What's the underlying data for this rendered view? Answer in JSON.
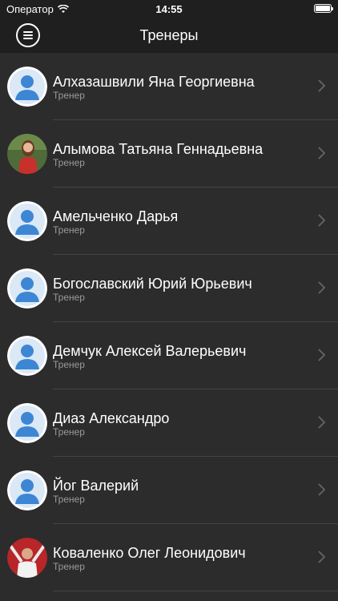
{
  "status": {
    "carrier": "Оператор",
    "time": "14:55"
  },
  "nav": {
    "title": "Тренеры"
  },
  "trainers": [
    {
      "name": "Алхазашвили Яна Георгиевна",
      "role": "Тренер",
      "avatar": "default-avatar"
    },
    {
      "name": "Алымова Татьяна Геннадьевна",
      "role": "Тренер",
      "avatar": "photo"
    },
    {
      "name": "Амельченко Дарья",
      "role": "Тренер",
      "avatar": "default-avatar"
    },
    {
      "name": "Богославский Юрий Юрьевич",
      "role": "Тренер",
      "avatar": "default-avatar"
    },
    {
      "name": "Демчук Алексей Валерьевич",
      "role": "Тренер",
      "avatar": "default-avatar"
    },
    {
      "name": "Диаз Александро",
      "role": "Тренер",
      "avatar": "default-avatar"
    },
    {
      "name": "Йог Валерий",
      "role": "Тренер",
      "avatar": "default-avatar"
    },
    {
      "name": "Коваленко Олег Леонидович",
      "role": "Тренер",
      "avatar": "photo"
    }
  ]
}
